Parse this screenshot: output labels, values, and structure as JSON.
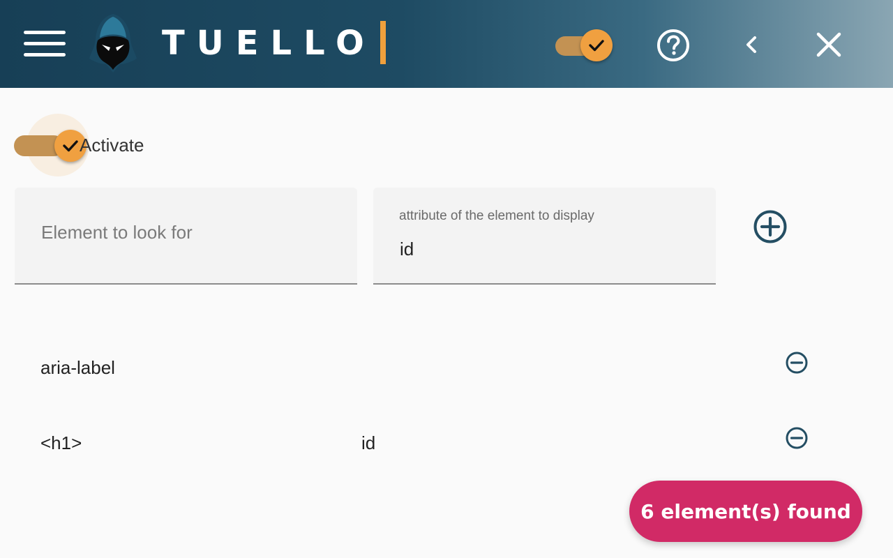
{
  "header": {
    "brand": "TUELLO",
    "menu_icon": "hamburger-menu-icon",
    "logo_icon": "hooded-ninja-logo",
    "toggle_on": true,
    "help_icon": "question-circle-icon",
    "back_icon": "chevron-left-icon",
    "close_icon": "close-icon"
  },
  "activate": {
    "label": "Activate",
    "checked": true
  },
  "form": {
    "element_placeholder": "Element to look for",
    "element_value": "",
    "attribute_label": "attribute of the element to display",
    "attribute_value": "id",
    "add_icon": "plus-circle-icon"
  },
  "rules": [
    {
      "element": "aria-label",
      "attribute": "",
      "remove_icon": "minus-circle-icon"
    },
    {
      "element": "<h1>",
      "attribute": "id",
      "remove_icon": "minus-circle-icon"
    }
  ],
  "found_badge": "6 element(s) found",
  "colors": {
    "header_dark": "#173f56",
    "accent_orange": "#f0a040",
    "badge_pink": "#d12a66",
    "icon_teal": "#244e63"
  }
}
